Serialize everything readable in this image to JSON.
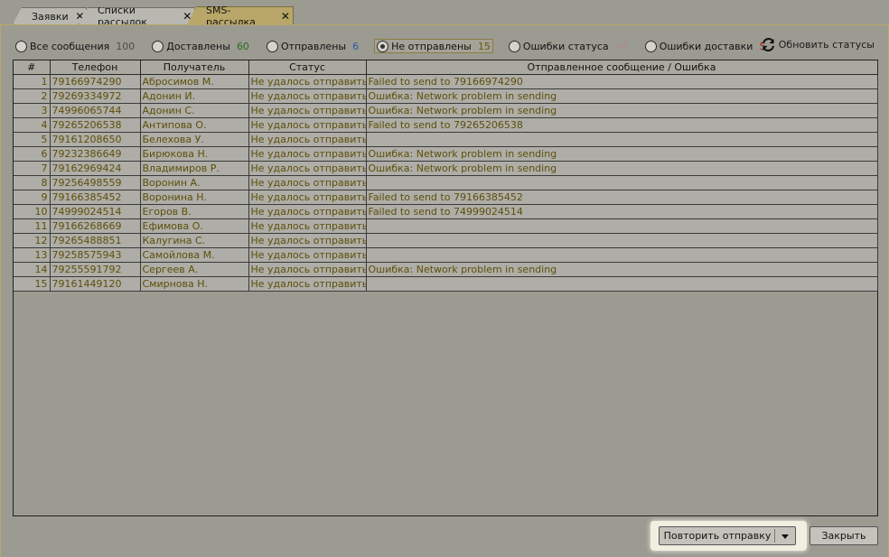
{
  "tabs": [
    {
      "label": "Заявки",
      "close": "✕"
    },
    {
      "label": "Списки рассылок",
      "close": "✕"
    },
    {
      "label": "SMS-рассылка",
      "close": "✕"
    }
  ],
  "filters": [
    {
      "label": "Все сообщения",
      "count": "100",
      "color": "#4a4a4a"
    },
    {
      "label": "Доставлены",
      "count": "60",
      "color": "#2c6a1c"
    },
    {
      "label": "Отправлены",
      "count": "6",
      "color": "#2a5aa8"
    },
    {
      "label": "Не отправлены",
      "count": "15",
      "color": "#6a5a10"
    },
    {
      "label": "Ошибки статуса",
      "count": "14",
      "color": "#b08a86"
    },
    {
      "label": "Ошибки доставки",
      "count": "5",
      "color": "#b01818"
    }
  ],
  "refresh_label": "Обновить статусы",
  "table": {
    "columns": [
      "#",
      "Телефон",
      "Получатель",
      "Статус",
      "Отправленное сообщение / Ошибка"
    ],
    "rows": [
      [
        "1",
        "79166974290",
        "Абросимов М.",
        "Не удалось отправить",
        "Failed to send to 79166974290"
      ],
      [
        "2",
        "79269334972",
        "Адонин И.",
        "Не удалось отправить",
        "Ошибка: Network problem in sending"
      ],
      [
        "3",
        "74996065744",
        "Адонин С.",
        "Не удалось отправить",
        "Ошибка: Network problem in sending"
      ],
      [
        "4",
        "79265206538",
        "Антипова О.",
        "Не удалось отправить",
        "Failed to send to 79265206538"
      ],
      [
        "5",
        "79161208650",
        "Белехова У.",
        "Не удалось отправить",
        ""
      ],
      [
        "6",
        "79232386649",
        "Бирюкова Н.",
        "Не удалось отправить",
        "Ошибка: Network problem in sending"
      ],
      [
        "7",
        "79162969424",
        "Владимиров Р.",
        "Не удалось отправить",
        "Ошибка: Network problem in sending"
      ],
      [
        "8",
        "79256498559",
        "Воронин А.",
        "Не удалось отправить",
        ""
      ],
      [
        "9",
        "79166385452",
        "Воронина Н.",
        "Не удалось отправить",
        "Failed to send to 79166385452"
      ],
      [
        "10",
        "74999024514",
        "Егоров В.",
        "Не удалось отправить",
        "Failed to send to 74999024514"
      ],
      [
        "11",
        "79166268669",
        "Ефимова О.",
        "Не удалось отправить",
        ""
      ],
      [
        "12",
        "79265488851",
        "Калугина С.",
        "Не удалось отправить",
        ""
      ],
      [
        "13",
        "79258575943",
        "Самойлова М.",
        "Не удалось отправить",
        ""
      ],
      [
        "14",
        "79255591792",
        "Сергеев А.",
        "Не удалось отправить",
        "Ошибка: Network problem in sending"
      ],
      [
        "15",
        "79161449120",
        "Смирнова Н.",
        "Не удалось отправить",
        ""
      ]
    ]
  },
  "buttons": {
    "retry": "Повторить отправку",
    "close": "Закрыть"
  }
}
